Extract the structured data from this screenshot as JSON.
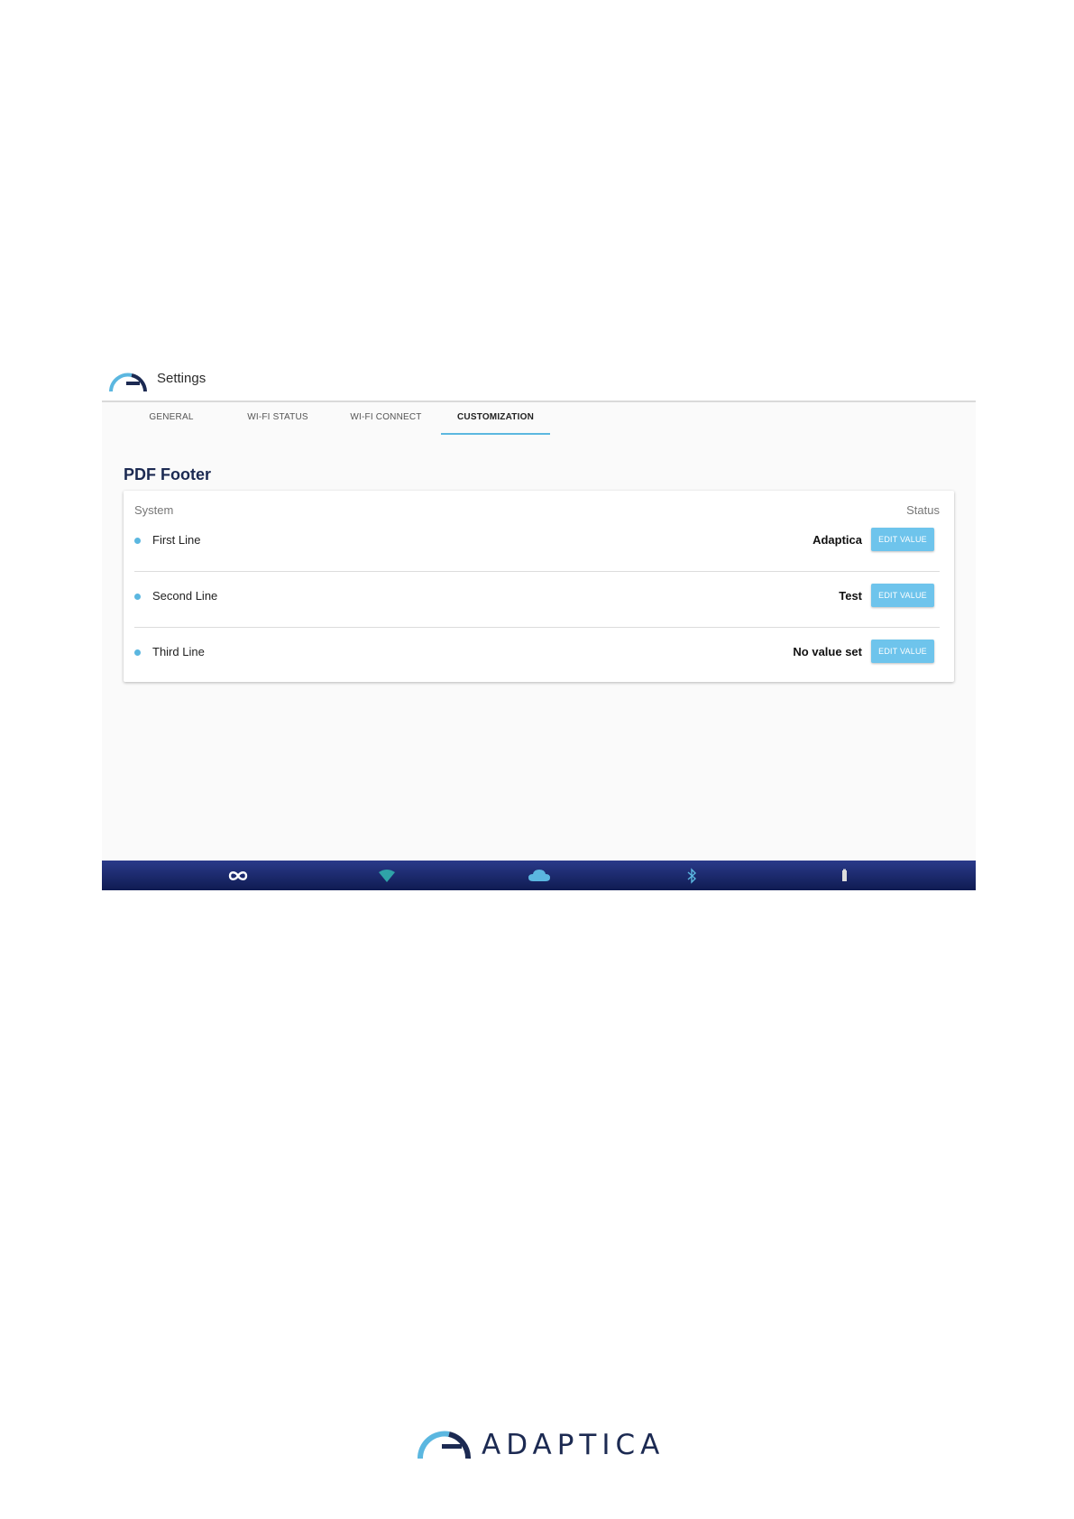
{
  "app": {
    "title": "Settings"
  },
  "tabs": [
    {
      "label": "GENERAL"
    },
    {
      "label": "WI-FI STATUS"
    },
    {
      "label": "WI-FI CONNECT"
    },
    {
      "label": "CUSTOMIZATION"
    }
  ],
  "active_tab": "CUSTOMIZATION",
  "section": {
    "title": "PDF Footer",
    "header_left": "System",
    "header_right": "Status",
    "rows": [
      {
        "label": "First Line",
        "value": "Adaptica",
        "button": "EDIT VALUE"
      },
      {
        "label": "Second Line",
        "value": "Test",
        "button": "EDIT VALUE"
      },
      {
        "label": "Third Line",
        "value": "No value set",
        "button": "EDIT VALUE"
      }
    ]
  },
  "status_bar": {
    "icons": [
      "infinity-icon",
      "wifi-icon",
      "cloud-icon",
      "bluetooth-icon",
      "battery-icon"
    ]
  },
  "footer": {
    "brand": "ADAPTICA"
  },
  "colors": {
    "accent": "#5bb7e0",
    "button": "#6ec4ec",
    "title": "#1c2a52",
    "bar_top": "#2a3a8a",
    "bar_bottom": "#0f1b52"
  }
}
